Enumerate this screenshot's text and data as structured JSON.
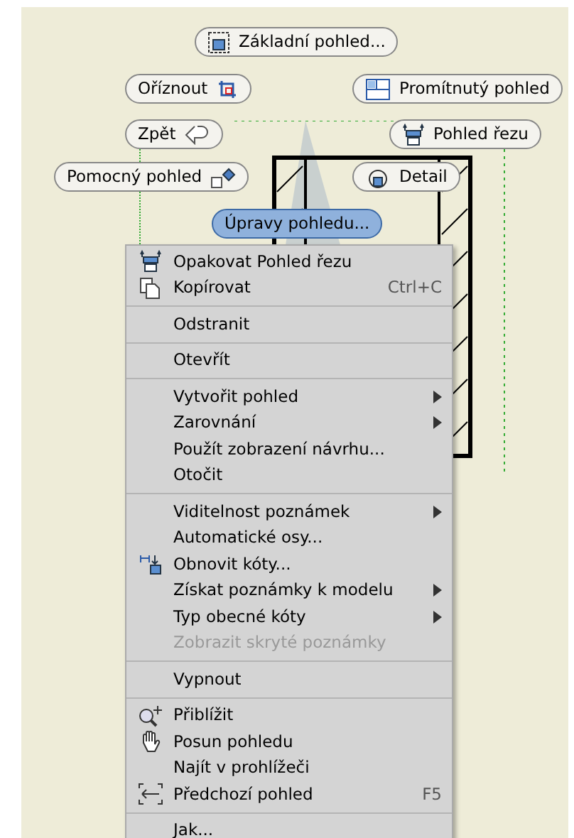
{
  "marking_menu": [
    {
      "label": "Základní pohled...",
      "selected": false
    },
    {
      "label": "Oříznout",
      "selected": false
    },
    {
      "label": "Promítnutý pohled",
      "selected": false
    },
    {
      "label": "Zpět",
      "selected": false
    },
    {
      "label": "Pohled řezu",
      "selected": false
    },
    {
      "label": "Pomocný pohled",
      "selected": false
    },
    {
      "label": "Detail",
      "selected": false
    },
    {
      "label": "Úpravy pohledu...",
      "selected": true
    }
  ],
  "context_menu": [
    [
      {
        "label": "Opakovat Pohled řezu",
        "disabled": false,
        "submenu": false
      },
      {
        "label": "Kopírovat",
        "shortcut": "Ctrl+C",
        "disabled": false,
        "submenu": false
      }
    ],
    [
      {
        "label": "Odstranit",
        "disabled": false,
        "submenu": false
      }
    ],
    [
      {
        "label": "Otevřít",
        "disabled": false,
        "submenu": false
      }
    ],
    [
      {
        "label": "Vytvořit pohled",
        "disabled": false,
        "submenu": true
      },
      {
        "label": "Zarovnání",
        "disabled": false,
        "submenu": true
      },
      {
        "label": "Použít zobrazení návrhu...",
        "disabled": false,
        "submenu": false
      },
      {
        "label": "Otočit",
        "disabled": false,
        "submenu": false
      }
    ],
    [
      {
        "label": "Viditelnost poznámek",
        "disabled": false,
        "submenu": true
      },
      {
        "label": "Automatické osy...",
        "disabled": false,
        "submenu": false
      },
      {
        "label": "Obnovit kóty...",
        "disabled": false,
        "submenu": false
      },
      {
        "label": "Získat poznámky k modelu",
        "disabled": false,
        "submenu": true
      },
      {
        "label": "Typ obecné kóty",
        "disabled": false,
        "submenu": true
      },
      {
        "label": "Zobrazit skryté poznámky",
        "disabled": true,
        "submenu": false
      }
    ],
    [
      {
        "label": "Vypnout",
        "disabled": false,
        "submenu": false
      }
    ],
    [
      {
        "label": "Přiblížit",
        "disabled": false,
        "submenu": false
      },
      {
        "label": "Posun pohledu",
        "disabled": false,
        "submenu": false
      },
      {
        "label": "Najít v prohlížeči",
        "disabled": false,
        "submenu": false
      },
      {
        "label": "Předchozí pohled",
        "shortcut": "F5",
        "disabled": false,
        "submenu": false
      }
    ],
    [
      {
        "label": "Jak...",
        "disabled": false,
        "submenu": false
      }
    ]
  ]
}
